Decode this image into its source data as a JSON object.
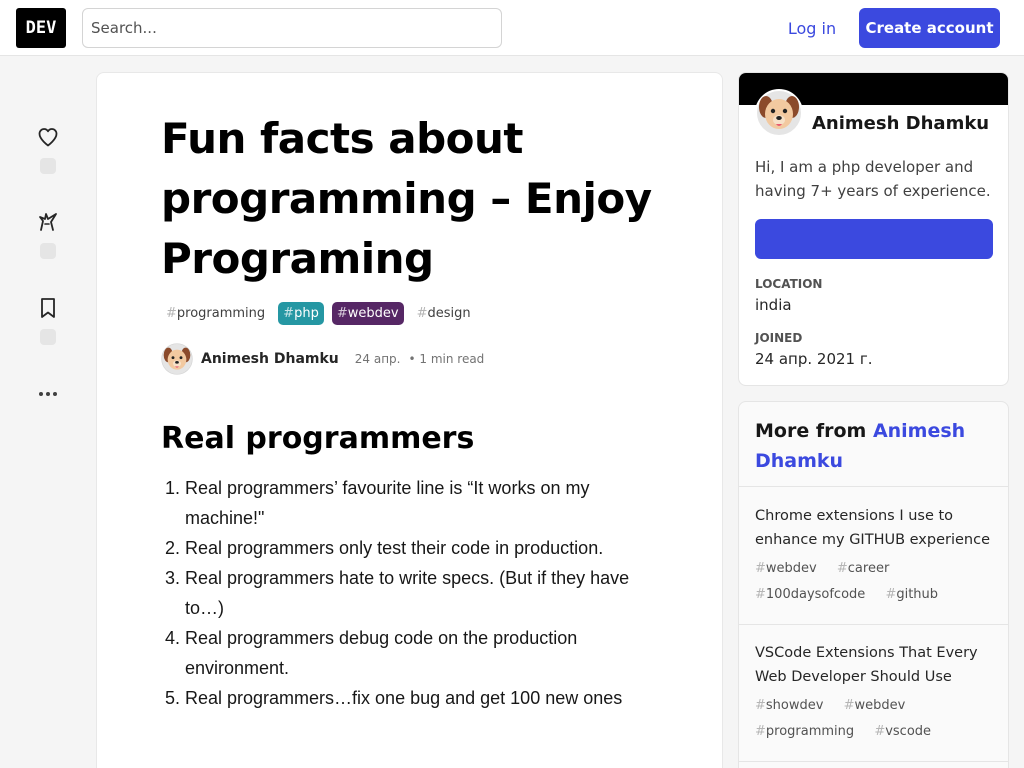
{
  "header": {
    "logo": "DEV",
    "search_placeholder": "Search...",
    "login_label": "Log in",
    "create_account_label": "Create account"
  },
  "article": {
    "title": "Fun facts about programming – Enjoy Programing",
    "tags": [
      {
        "name": "programming",
        "color": ""
      },
      {
        "name": "php",
        "color": "#2597a3"
      },
      {
        "name": "webdev",
        "color": "#562765"
      },
      {
        "name": "design",
        "color": ""
      }
    ],
    "author": "Animesh Dhamku",
    "date": "24 апр.",
    "read_time": "• 1 min read",
    "heading": "Real programmers",
    "list": [
      "Real programmers’ favourite line is “It works on my machine!\"",
      "Real programmers only test their code in production.",
      "Real programmers hate to write specs. (But if they have to…)",
      "Real programmers debug code on the production environment.",
      "Real programmers…fix one bug and get 100 new ones"
    ]
  },
  "profile": {
    "name": "Animesh Dhamku",
    "bio": "Hi, I am a php developer and having 7+ years of experience.",
    "location_label": "Location",
    "location": "india",
    "joined_label": "Joined",
    "joined": "24 апр. 2021 г."
  },
  "more_from": {
    "prefix": "More from ",
    "author": "Animesh Dhamku",
    "posts": [
      {
        "title": "Chrome extensions I use to enhance my GITHUB experience",
        "tags": [
          "webdev",
          "career",
          "100daysofcode",
          "github"
        ]
      },
      {
        "title": "VSCode Extensions That Every Web Developer Should Use",
        "tags": [
          "showdev",
          "webdev",
          "programming",
          "vscode"
        ]
      }
    ]
  },
  "colors": {
    "accent": "#3b49df",
    "php_tag": "#2597a3",
    "webdev_tag": "#562765"
  }
}
